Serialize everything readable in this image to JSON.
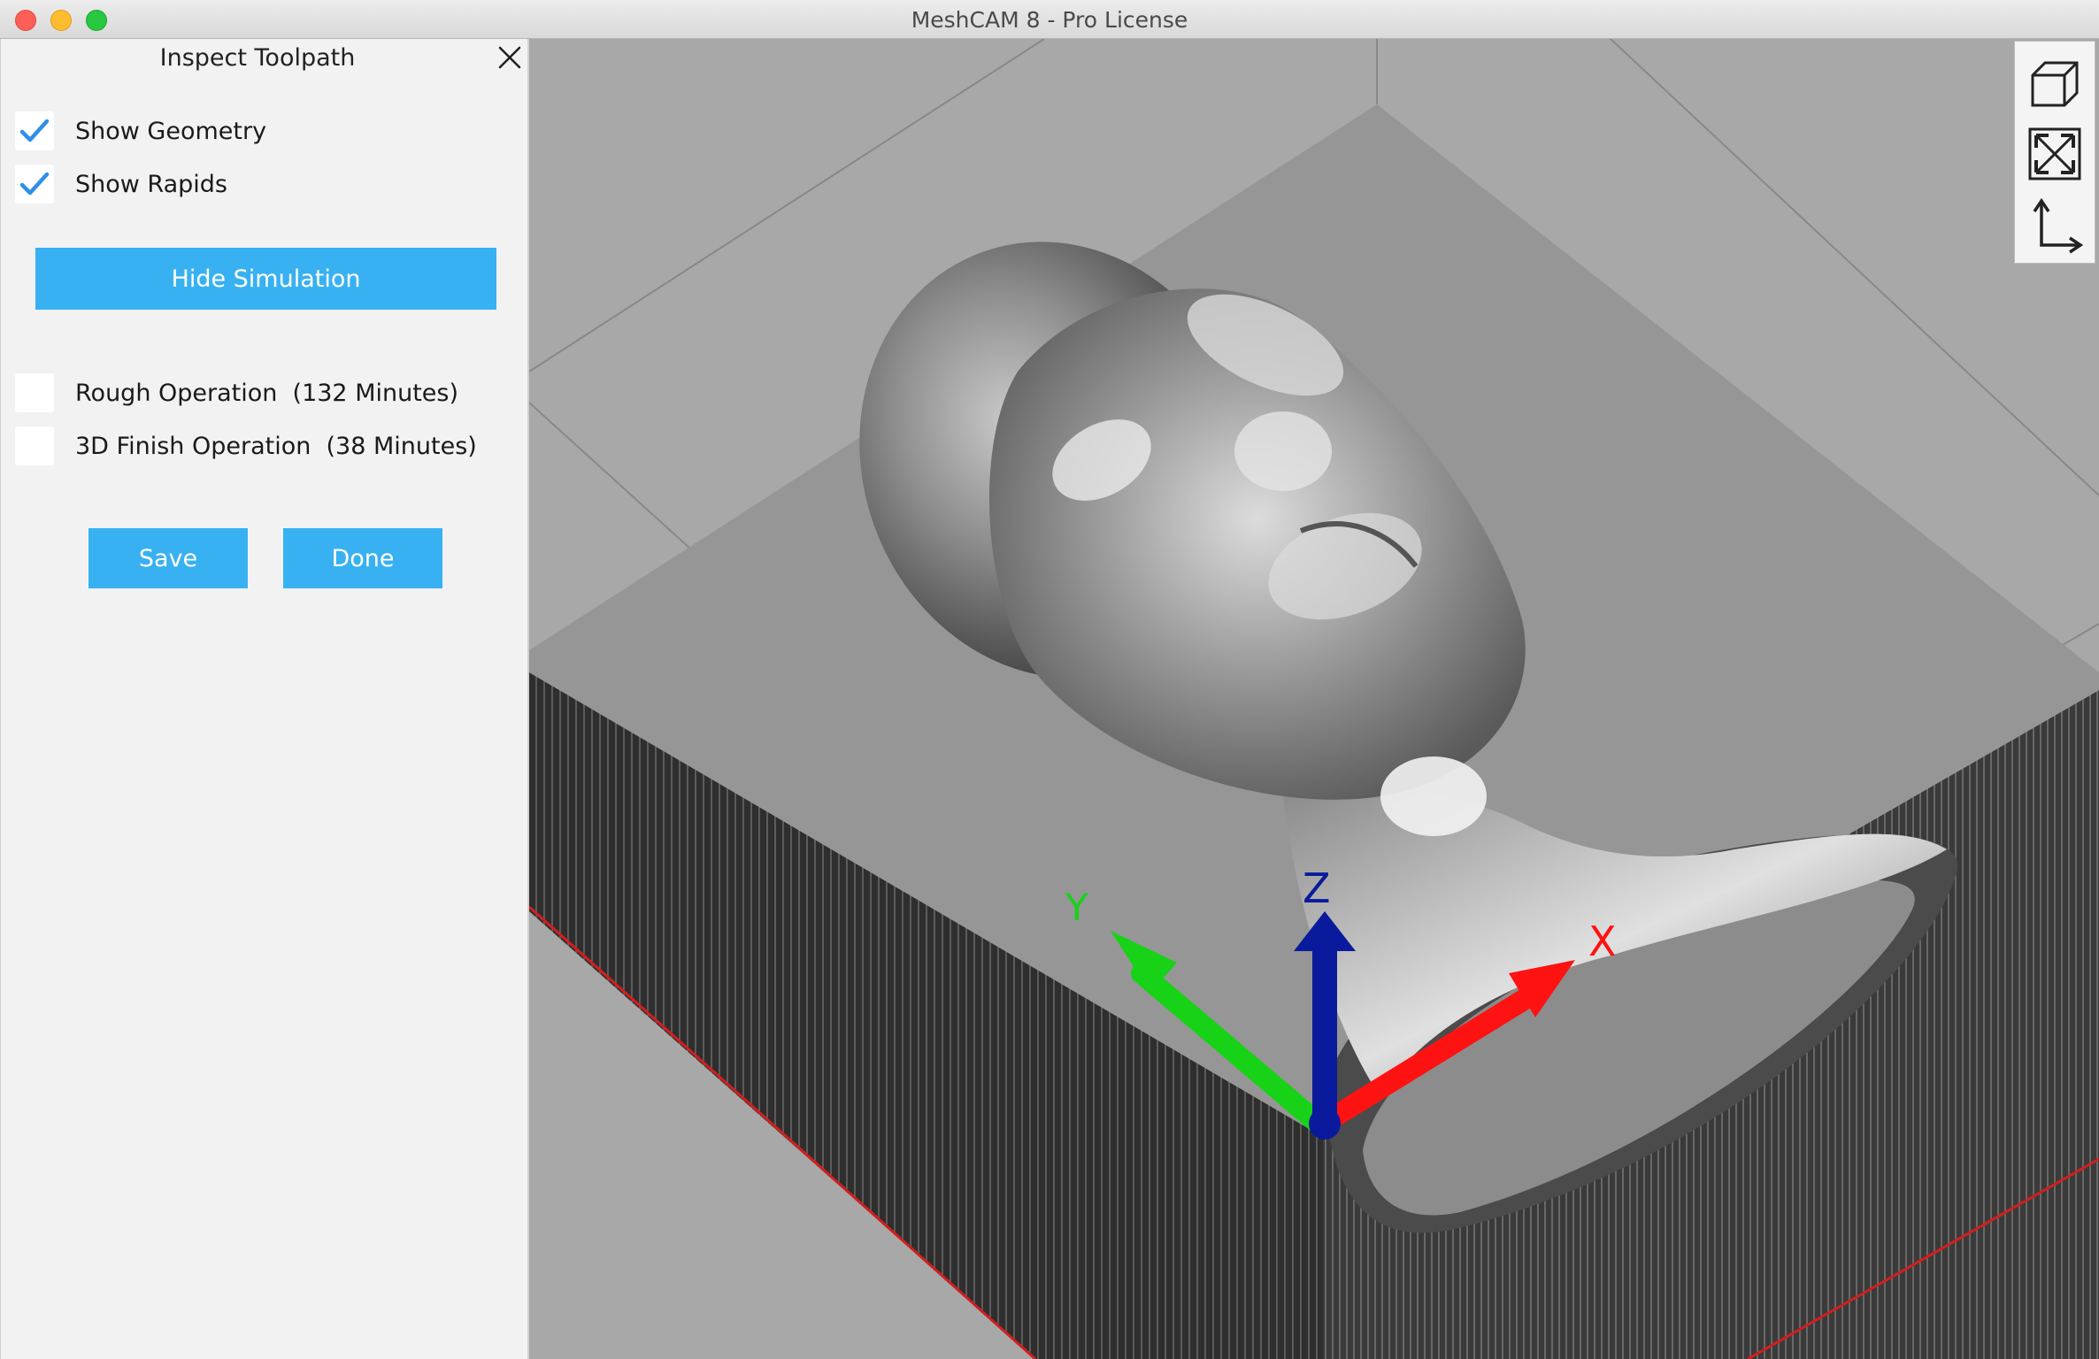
{
  "window": {
    "title": "MeshCAM 8 - Pro License"
  },
  "panel": {
    "title": "Inspect Toolpath",
    "options": [
      {
        "label": "Show Geometry",
        "checked": true
      },
      {
        "label": "Show Rapids",
        "checked": true
      }
    ],
    "simulation_button": "Hide Simulation",
    "operations": [
      {
        "label": "Rough Operation  (132 Minutes)",
        "checked": false
      },
      {
        "label": "3D Finish Operation  (38 Minutes)",
        "checked": false
      }
    ],
    "save_button": "Save",
    "done_button": "Done"
  },
  "viewport": {
    "axes": {
      "x": "X",
      "y": "Y",
      "z": "Z"
    },
    "toolbar": [
      "iso-view-icon",
      "zoom-fit-icon",
      "axes-view-icon"
    ]
  },
  "colors": {
    "accent": "#38b1f2",
    "check": "#2f8fe8",
    "axis_x": "#ff1010",
    "axis_y": "#10e010",
    "axis_z": "#0a1a9c"
  }
}
